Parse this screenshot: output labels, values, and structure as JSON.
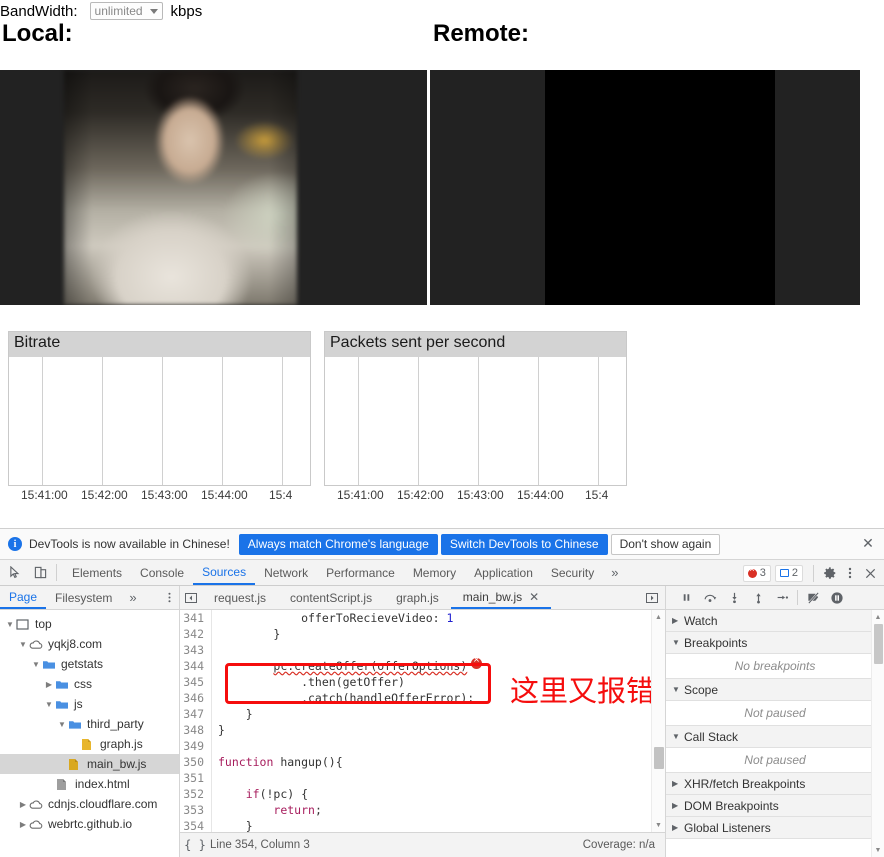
{
  "page": {
    "bandwidth_label": "BandWidth:",
    "bandwidth_value": "unlimited",
    "bandwidth_units": "kbps",
    "local_heading": "Local:",
    "remote_heading": "Remote:"
  },
  "chart_data": [
    {
      "type": "line",
      "title": "Bitrate",
      "xlabel": "",
      "ylabel": "",
      "series": [
        {
          "name": "bitrate",
          "values": []
        }
      ],
      "x_ticks": [
        "15:41:00",
        "15:42:00",
        "15:43:00",
        "15:44:00",
        "15:4"
      ],
      "grid": true,
      "legend": "none",
      "note": "empty plot — no data plotted yet"
    },
    {
      "type": "line",
      "title": "Packets sent per second",
      "xlabel": "",
      "ylabel": "",
      "series": [
        {
          "name": "packets",
          "values": []
        }
      ],
      "x_ticks": [
        "15:41:00",
        "15:42:00",
        "15:43:00",
        "15:44:00",
        "15:4"
      ],
      "grid": true,
      "legend": "none",
      "note": "empty plot — no data plotted yet"
    }
  ],
  "devtools": {
    "infobar": {
      "text": "DevTools is now available in Chinese!",
      "btn_always": "Always match Chrome's language",
      "btn_switch": "Switch DevTools to Chinese",
      "btn_dismiss": "Don't show again",
      "close": "✕"
    },
    "tabs": [
      {
        "label": "Elements",
        "active": false
      },
      {
        "label": "Console",
        "active": false
      },
      {
        "label": "Sources",
        "active": true
      },
      {
        "label": "Network",
        "active": false
      },
      {
        "label": "Performance",
        "active": false
      },
      {
        "label": "Memory",
        "active": false
      },
      {
        "label": "Application",
        "active": false
      },
      {
        "label": "Security",
        "active": false
      }
    ],
    "overflow_chevron": "»",
    "error_count": "3",
    "message_count": "2",
    "nav_tabs": [
      {
        "label": "Page",
        "active": true
      },
      {
        "label": "Filesystem",
        "active": false
      }
    ],
    "nav_overflow": "»",
    "file_tree": [
      {
        "label": "top",
        "indent": 0,
        "twisty": "▼",
        "icon": "frame",
        "selected": false
      },
      {
        "label": "yqkj8.com",
        "indent": 1,
        "twisty": "▼",
        "icon": "cloud",
        "selected": false
      },
      {
        "label": "getstats",
        "indent": 2,
        "twisty": "▼",
        "icon": "folder",
        "selected": false
      },
      {
        "label": "css",
        "indent": 3,
        "twisty": "▶",
        "icon": "folder",
        "selected": false
      },
      {
        "label": "js",
        "indent": 3,
        "twisty": "▼",
        "icon": "folder",
        "selected": false
      },
      {
        "label": "third_party",
        "indent": 4,
        "twisty": "▼",
        "icon": "folder",
        "selected": false
      },
      {
        "label": "graph.js",
        "indent": 5,
        "twisty": "",
        "icon": "jsfile",
        "selected": false
      },
      {
        "label": "main_bw.js",
        "indent": 4,
        "twisty": "",
        "icon": "jsfile",
        "selected": true
      },
      {
        "label": "index.html",
        "indent": 3,
        "twisty": "",
        "icon": "html",
        "selected": false
      },
      {
        "label": "cdnjs.cloudflare.com",
        "indent": 1,
        "twisty": "▶",
        "icon": "cloud",
        "selected": false
      },
      {
        "label": "webrtc.github.io",
        "indent": 1,
        "twisty": "▶",
        "icon": "cloud",
        "selected": false
      }
    ],
    "editor_tabs": [
      {
        "label": "request.js",
        "active": false
      },
      {
        "label": "contentScript.js",
        "active": false
      },
      {
        "label": "graph.js",
        "active": false
      },
      {
        "label": "main_bw.js",
        "active": true
      }
    ],
    "code_lines": [
      {
        "num": "341",
        "text": "            offerToRecieveVideo: 1"
      },
      {
        "num": "342",
        "text": "        }"
      },
      {
        "num": "343",
        "text": ""
      },
      {
        "num": "344",
        "text": "        pc.createOffer(offerOptions)"
      },
      {
        "num": "345",
        "text": "            .then(getOffer)"
      },
      {
        "num": "346",
        "text": "            .catch(handleOfferError);"
      },
      {
        "num": "347",
        "text": "    }"
      },
      {
        "num": "348",
        "text": "}"
      },
      {
        "num": "349",
        "text": ""
      },
      {
        "num": "350",
        "text": "function hangup(){"
      },
      {
        "num": "351",
        "text": ""
      },
      {
        "num": "352",
        "text": "    if(!pc) {"
      },
      {
        "num": "353",
        "text": "        return;"
      },
      {
        "num": "354",
        "text": "    }"
      },
      {
        "num": "355",
        "text": ""
      }
    ],
    "annotation_text": "这里又报错",
    "status": {
      "pretty_print": "{ }",
      "cursor": "Line 354, Column 3",
      "coverage": "Coverage: n/a"
    },
    "debugger_sections": [
      {
        "label": "Watch",
        "caret": "▶",
        "body": null
      },
      {
        "label": "Breakpoints",
        "caret": "▼",
        "body": "No breakpoints"
      },
      {
        "label": "Scope",
        "caret": "▼",
        "body": "Not paused"
      },
      {
        "label": "Call Stack",
        "caret": "▼",
        "body": "Not paused"
      },
      {
        "label": "XHR/fetch Breakpoints",
        "caret": "▶",
        "body": null
      },
      {
        "label": "DOM Breakpoints",
        "caret": "▶",
        "body": null
      },
      {
        "label": "Global Listeners",
        "caret": "▶",
        "body": null
      }
    ]
  },
  "colors": {
    "accent": "#1a73e8",
    "error": "#d93025",
    "annotation": "#f50d0d",
    "graph_header": "#d3d3d3"
  }
}
